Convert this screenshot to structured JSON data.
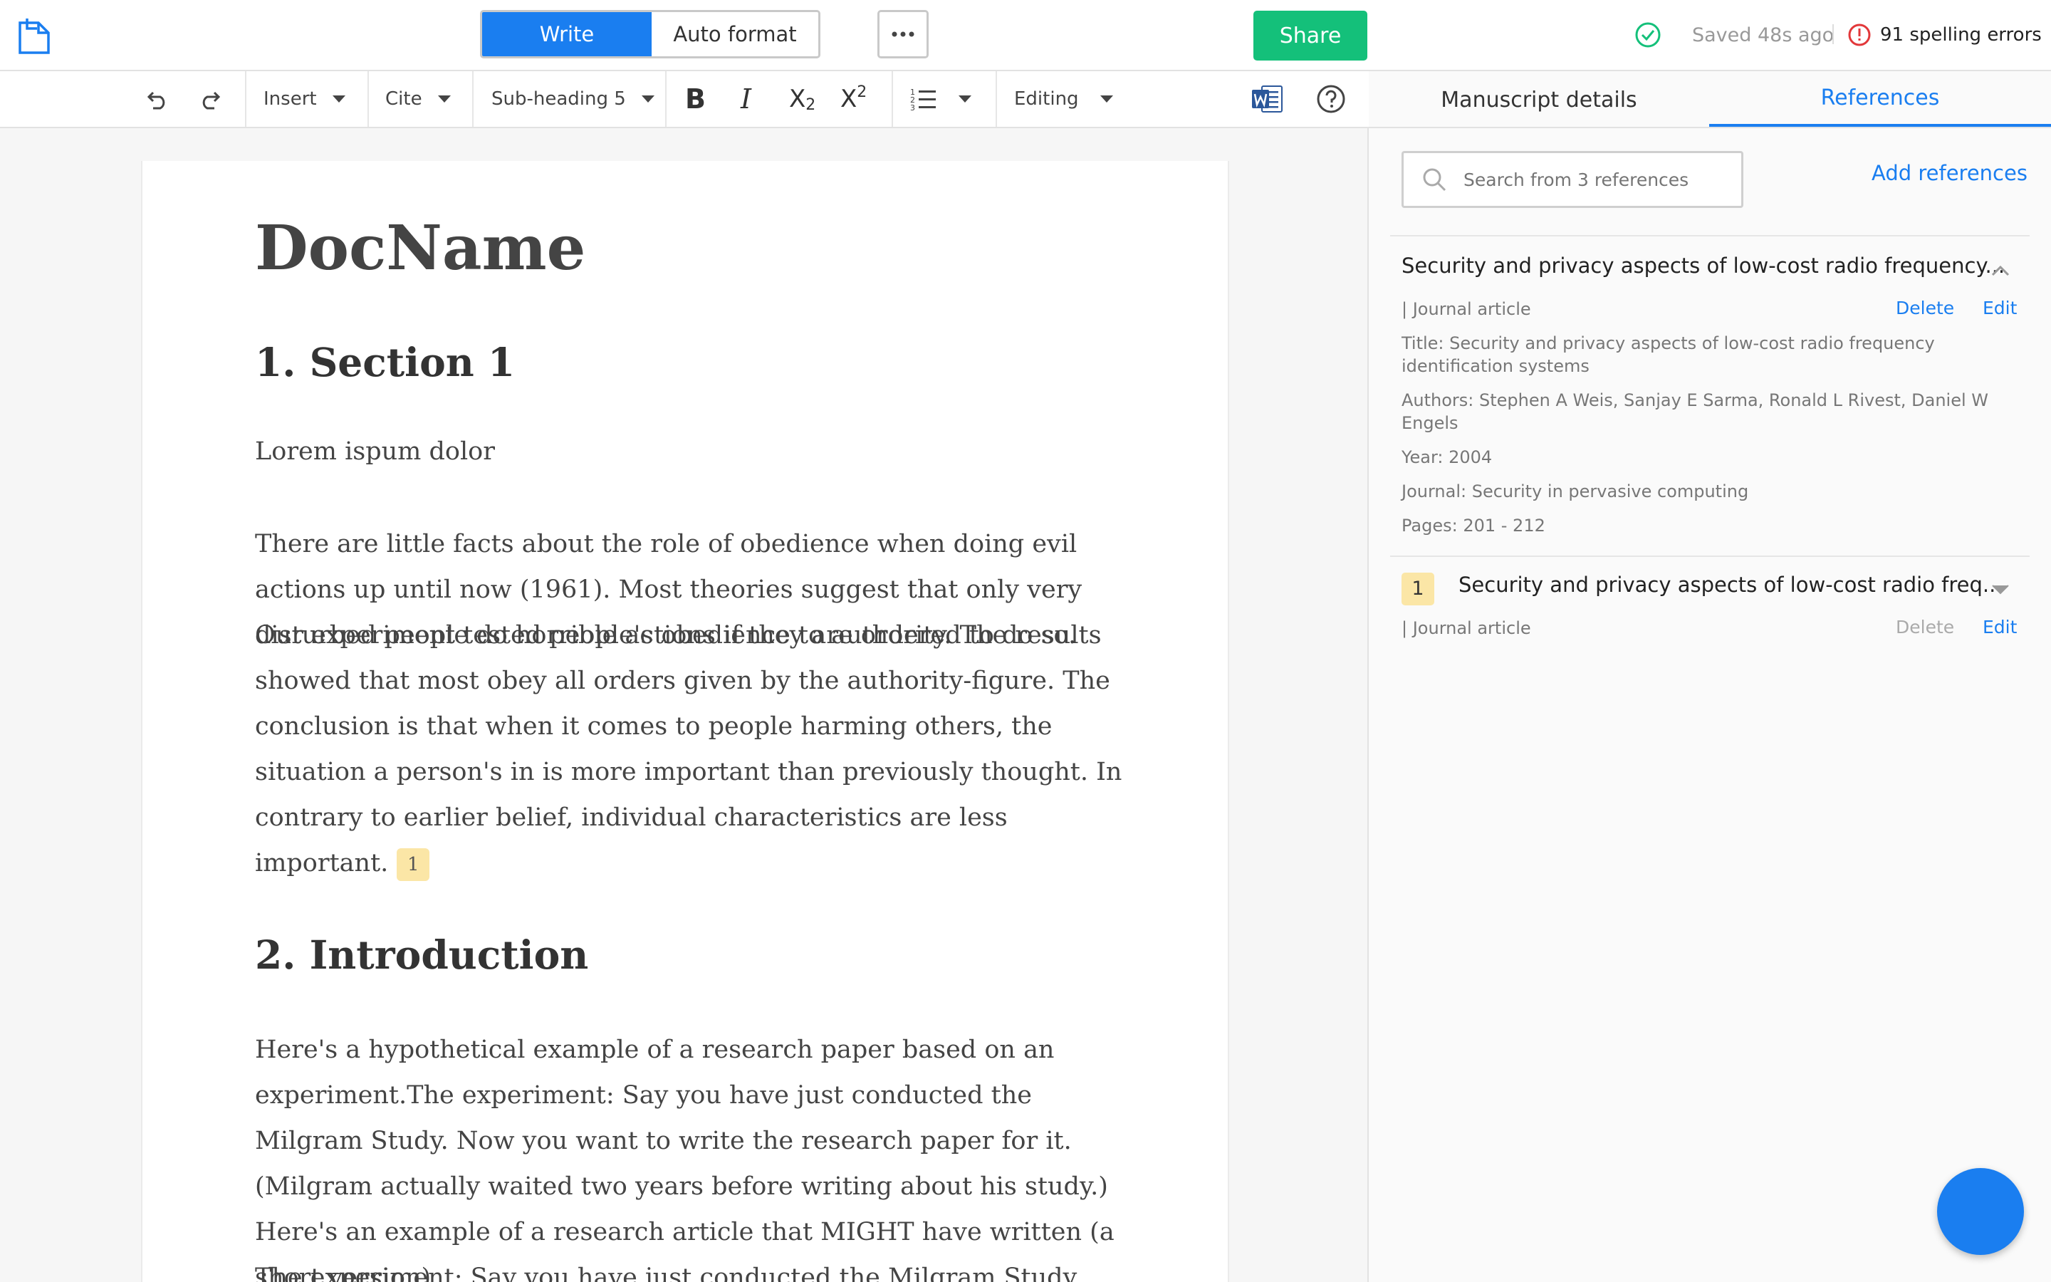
{
  "header": {
    "mode_write": "Write",
    "mode_auto_format": "Auto format",
    "share": "Share",
    "saved_status": "Saved 48s ago",
    "spelling_errors": "91 spelling errors"
  },
  "toolbar": {
    "insert": "Insert",
    "cite": "Cite",
    "style": "Sub-heading 5",
    "editing": "Editing"
  },
  "document": {
    "title": "DocName",
    "section1_heading": "1. Section 1",
    "section1_lead": "Lorem ispum dolor",
    "section1_body": "There are little facts about the role of obedience when doing evil actions up until now (1961). Most theories suggest that only very disturbed people do horrible actions if they are ordered to do so.",
    "section1_body2": "Our experiment tested people's obedience to authority. The results showed that most obey all orders given by the authority-figure. The conclusion is that when it comes to people harming others, the situation a person's in is more important than previously thought. In contrary to earlier belief, individual characteristics are less important.",
    "citation_badge": "1",
    "section2_heading": "2. Introduction",
    "section2_body": "Here's a hypothetical example of a research paper based on an experiment.The experiment: Say you have just conducted the Milgram Study. Now you want to write the research paper for it. (Milgram actually waited two years before writing about his study.) Here's an example of a research article that MIGHT have written (a short version).",
    "section2_body2": "The experiment: Say you have just conducted the Milgram Study. Now"
  },
  "side_panel": {
    "tabs": [
      "Manuscript details",
      "References"
    ],
    "active_tab": "References",
    "search_placeholder": "Search from 3 references",
    "add_references": "Add references",
    "references": [
      {
        "title": "Security and privacy aspects of low-cost radio frequency...",
        "type": "| Journal article",
        "delete": "Delete",
        "edit": "Edit",
        "full_title": "Title: Security and privacy aspects of low-cost radio frequency identification systems",
        "authors": "Authors: Stephen A Weis, Sanjay E Sarma, Ronald L Rivest, Daniel W Engels",
        "year": "Year: 2004",
        "journal": "Journal: Security in pervasive computing",
        "pages": "Pages: 201 - 212",
        "expanded": true
      },
      {
        "number": "1",
        "title": "Security and privacy aspects of low-cost radio freq...",
        "type": "| Journal article",
        "delete": "Delete",
        "edit": "Edit",
        "expanded": false
      }
    ]
  },
  "colors": {
    "accent": "#1a7ef0",
    "share": "#14c07a",
    "saved_ok": "#14c07a",
    "error": "#e2383a",
    "citation_highlight": "#fbe6a6"
  }
}
